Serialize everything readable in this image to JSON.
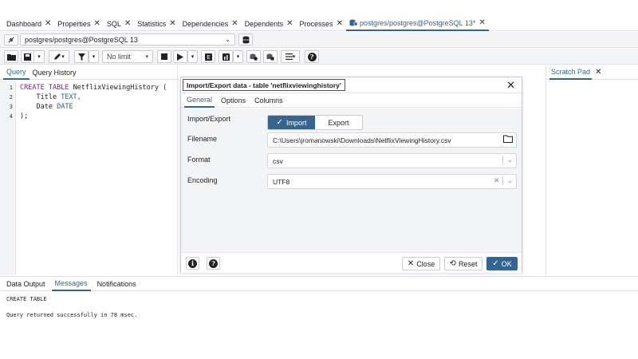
{
  "tabs": [
    {
      "label": "Dashboard"
    },
    {
      "label": "Properties"
    },
    {
      "label": "SQL"
    },
    {
      "label": "Statistics"
    },
    {
      "label": "Dependencies"
    },
    {
      "label": "Dependents"
    },
    {
      "label": "Processes"
    },
    {
      "label": "postgres/postgres@PostgreSQL 13*"
    }
  ],
  "connection": {
    "value": "postgres/postgres@PostgreSQL 13"
  },
  "toolbar": {
    "limit_label": "No limit"
  },
  "editor_tabs": {
    "query": "Query",
    "history": "Query History"
  },
  "editor": {
    "line_numbers": [
      "1",
      "2",
      "3",
      "4"
    ],
    "line1": {
      "kw1": "CREATE",
      "kw2": "TABLE",
      "rest": "NetflixViewingHistory ("
    },
    "line2": {
      "name": "Title",
      "type": "TEXT,"
    },
    "line3": {
      "name": "Date",
      "type": "DATE"
    },
    "line4": {
      "text": ");"
    }
  },
  "scratch": {
    "label": "Scratch Pad"
  },
  "dialog": {
    "title": "Import/Export data - table 'netflixviewinghistory'",
    "tabs": [
      "General",
      "Options",
      "Columns"
    ],
    "import_export_label": "Import/Export",
    "toggle_import": "Import",
    "toggle_export": "Export",
    "filename_label": "Filename",
    "filename_value": "C:\\Users\\jromanowski\\Downloads\\NetflixViewingHistory.csv",
    "format_label": "Format",
    "format_value": "csv",
    "encoding_label": "Encoding",
    "encoding_value": "UTF8",
    "close_label": "Close",
    "reset_label": "Reset",
    "ok_label": "OK"
  },
  "bottom": {
    "tabs": [
      "Data Output",
      "Messages",
      "Notifications"
    ],
    "msg1": "CREATE TABLE",
    "msg2": "Query returned successfully in 78 msec."
  },
  "colors": {
    "accent": "#326690",
    "keyword": "#7a1fa2",
    "type": "#2c59a9"
  }
}
